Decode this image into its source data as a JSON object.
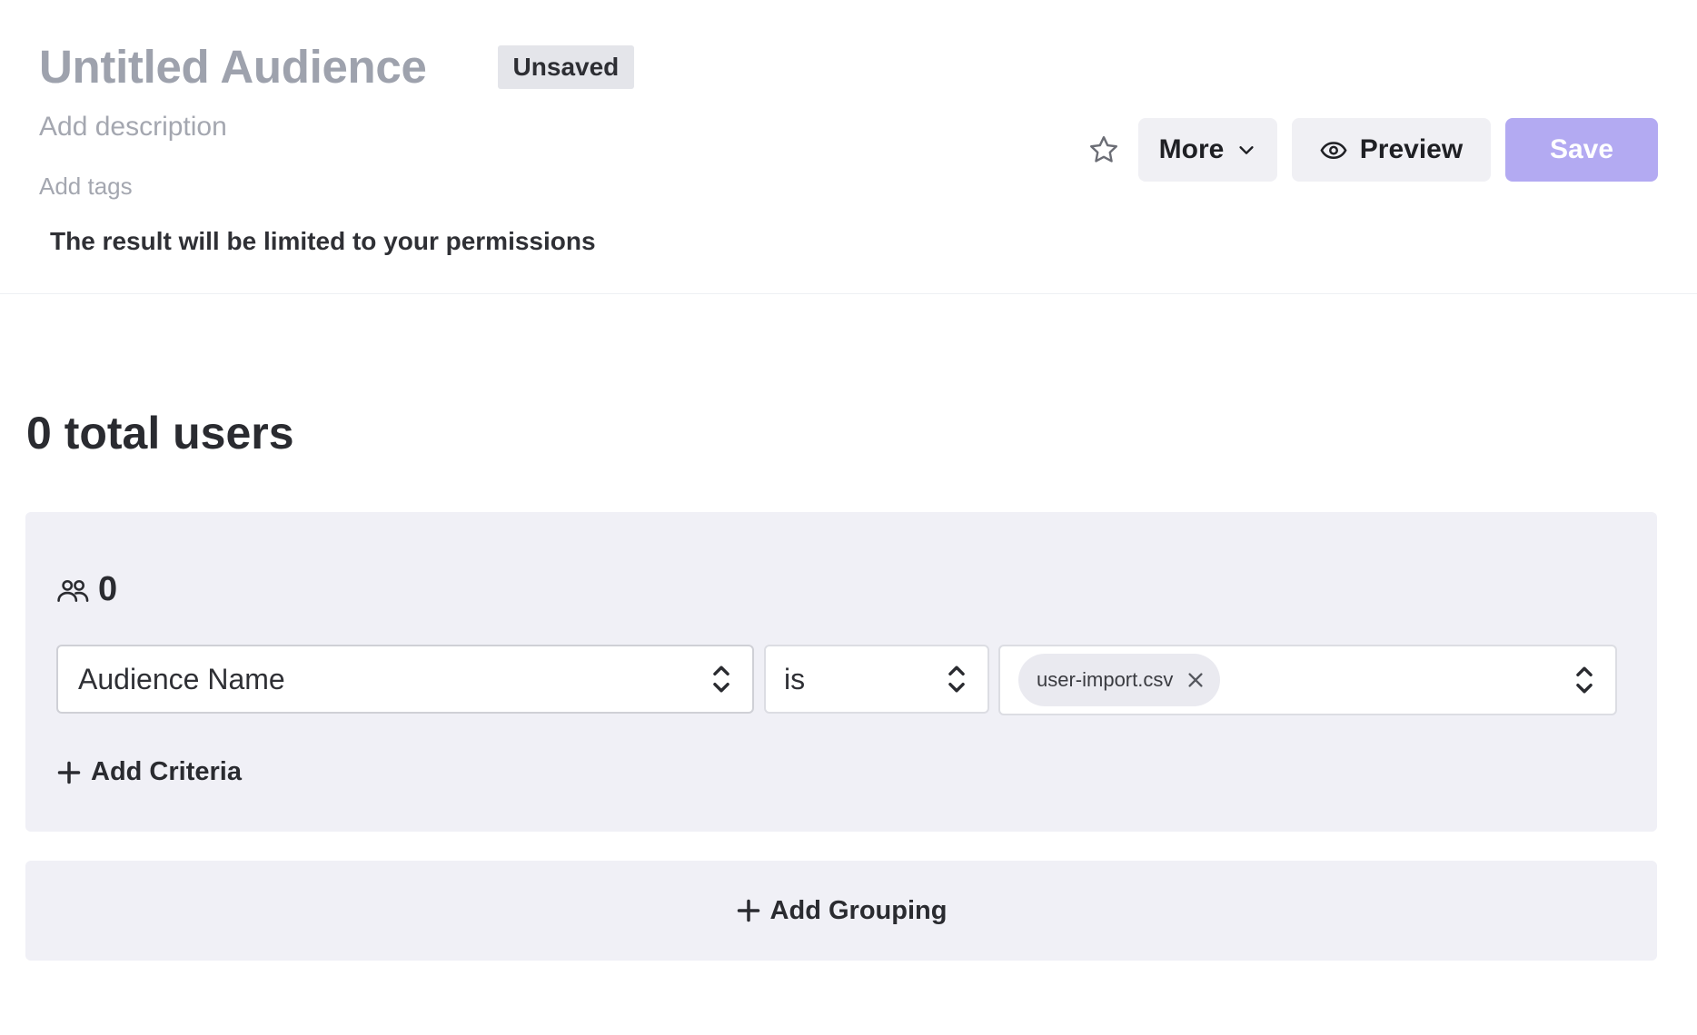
{
  "header": {
    "title": "Untitled Audience",
    "status_badge": "Unsaved",
    "description_placeholder": "Add description",
    "tags_placeholder": "Add tags",
    "permissions_note": "The result will be limited to your permissions",
    "actions": {
      "more_label": "More",
      "preview_label": "Preview",
      "save_label": "Save"
    }
  },
  "summary": {
    "total_users": "0 total users"
  },
  "group": {
    "count": "0",
    "criteria": [
      {
        "field": "Audience Name",
        "operator": "is",
        "values": [
          "user-import.csv"
        ]
      }
    ],
    "add_criteria_label": "Add Criteria"
  },
  "add_grouping_label": "Add Grouping",
  "colors": {
    "save_button_bg": "#b3aaf2",
    "card_bg": "#f0f0f6",
    "badge_bg": "#e4e5ea",
    "title_color": "#9ea2ad"
  },
  "icons": {
    "favorite": "star-icon",
    "more_dropdown": "chevron-down-icon",
    "preview": "eye-icon",
    "group_count": "users-icon",
    "select_caret": "up-down-caret-icon",
    "chip_remove": "close-icon",
    "add": "plus-icon"
  }
}
